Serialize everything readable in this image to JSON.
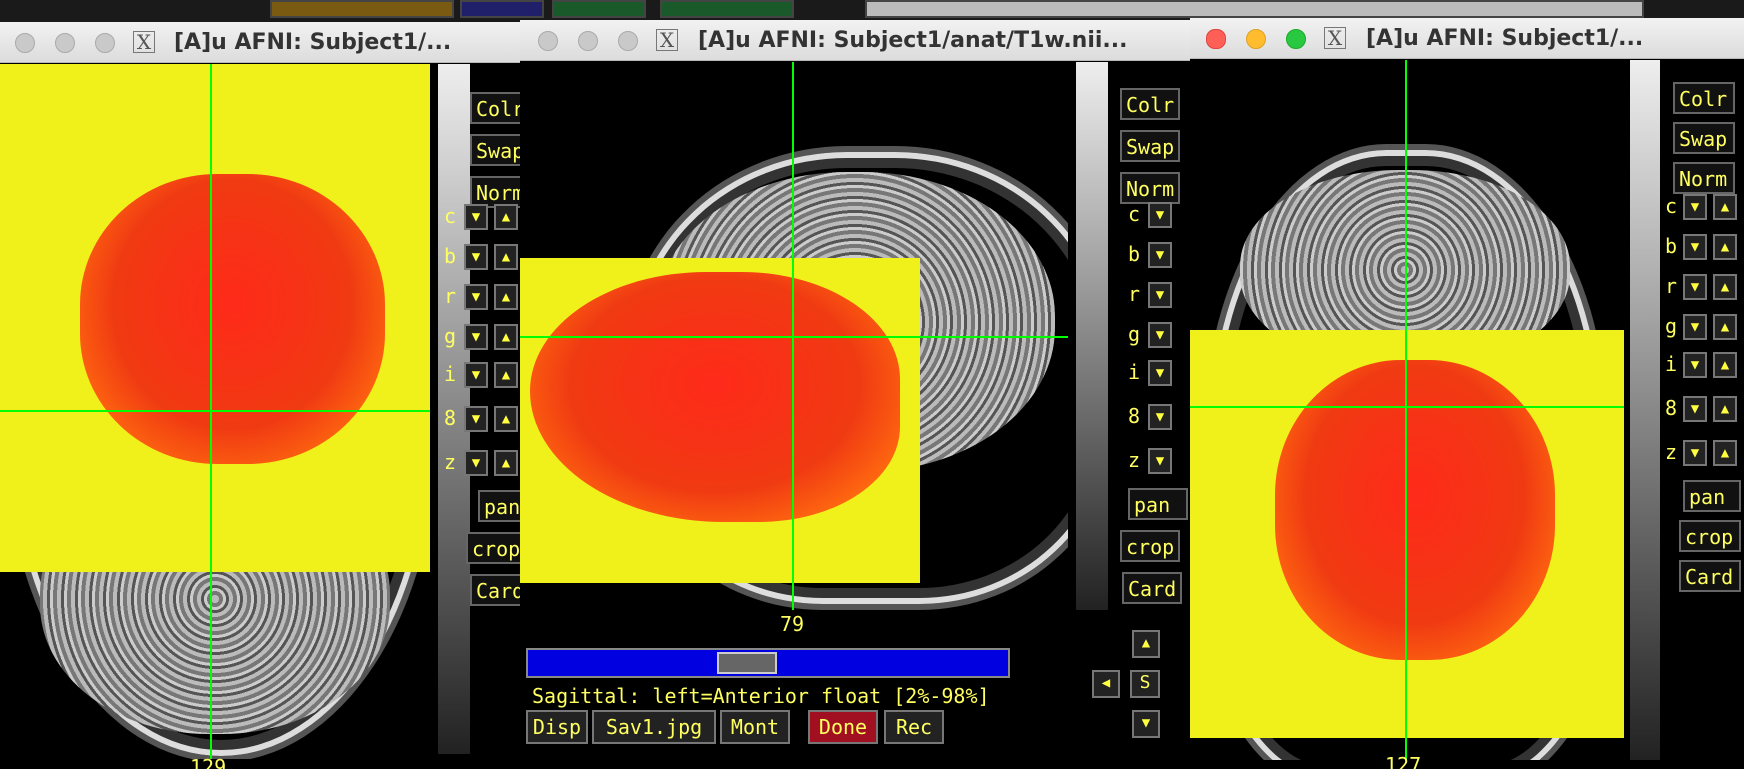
{
  "windows": [
    {
      "title": "[A]u AFNI: Subject1/...",
      "slice_number": "129",
      "buttons": [
        "Colr",
        "Swap",
        "Norm"
      ],
      "controls": [
        "c",
        "b",
        "r",
        "g",
        "i",
        "8",
        "z"
      ],
      "side_buttons": [
        "pan",
        "crop"
      ],
      "card_label": "Card"
    },
    {
      "title": "[A]u AFNI: Subject1/anat/T1w.nii...",
      "slice_number": "79",
      "buttons": [
        "Colr",
        "Swap",
        "Norm"
      ],
      "controls": [
        "c",
        "b",
        "r",
        "g",
        "i",
        "8",
        "z"
      ],
      "side_buttons": [
        "pan",
        "crop"
      ],
      "card_label": "Card",
      "status_text": "Sagittal: left=Anterior float [2%-98%]",
      "bottom_buttons": [
        "Disp",
        "Sav1.jpg",
        "Mont",
        "Done",
        "Rec"
      ],
      "slider_position": 0.45,
      "nav_label": "S"
    },
    {
      "title": "[A]u AFNI: Subject1/...",
      "slice_number": "127",
      "buttons": [
        "Colr",
        "Swap",
        "Norm"
      ],
      "controls": [
        "c",
        "b",
        "r",
        "g",
        "i",
        "8",
        "z"
      ],
      "side_buttons": [
        "pan",
        "crop"
      ],
      "card_label": "Card"
    }
  ],
  "colors": {
    "overlay_yellow": "#f0f01a",
    "overlay_red": "#f03a12",
    "crosshair": "#00ff00",
    "label_yellow": "#ffff60",
    "done_red": "#a01020",
    "slider_blue": "#0000e0"
  },
  "icons": {
    "close": "close-icon",
    "minimize": "minimize-icon",
    "zoom": "zoom-icon",
    "x11": "x11-icon",
    "arrow_down": "arrow-down-icon",
    "arrow_up": "arrow-up-icon"
  }
}
